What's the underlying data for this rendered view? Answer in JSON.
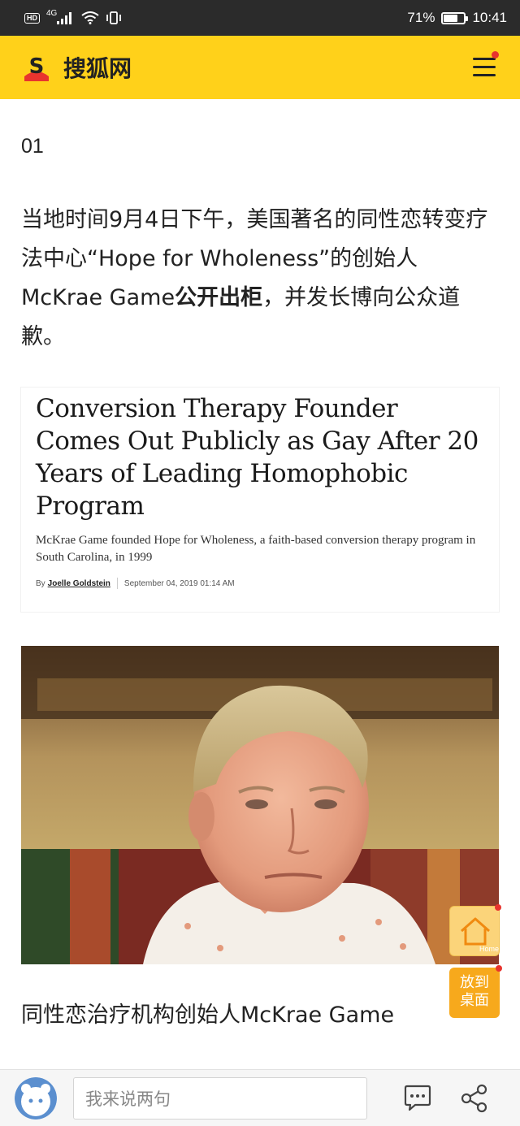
{
  "status_bar": {
    "hd_label": "HD",
    "network": "4G",
    "battery_percent": "71%",
    "battery_level": 0.71,
    "time": "10:41"
  },
  "header": {
    "brand": "搜狐网",
    "logo_letter": "S",
    "menu_icon": "hamburger-icon",
    "colors": {
      "background": "#ffd11a",
      "notification": "#e8342e"
    }
  },
  "article": {
    "section_number": "01",
    "paragraph": {
      "before": "当地时间9月4日下午，美国著名的同性恋转变疗法中心“Hope for Wholeness”的创始人McKrae Game",
      "bold": "公开出柜",
      "after": "，并发长博向公众道歉。"
    },
    "news_card": {
      "headline": "Conversion Therapy Founder Comes Out Publicly as Gay After 20 Years of Leading Homophobic Program",
      "dek": "McKrae Game founded Hope for Wholeness, a faith-based conversion therapy program in South Carolina, in 1999",
      "byline_prefix": "By",
      "author": "Joelle Goldstein",
      "date": "September 04, 2019 01:14 AM"
    },
    "caption": "同性恋治疗机构创始人McKrae Game"
  },
  "floating": {
    "home_icon": "home-icon",
    "home_label": "Home",
    "desk_line1": "放到",
    "desk_line2": "桌面"
  },
  "bottom_bar": {
    "comment_placeholder": "我来说两句",
    "comment_icon": "comment-icon",
    "share_icon": "share-icon"
  }
}
